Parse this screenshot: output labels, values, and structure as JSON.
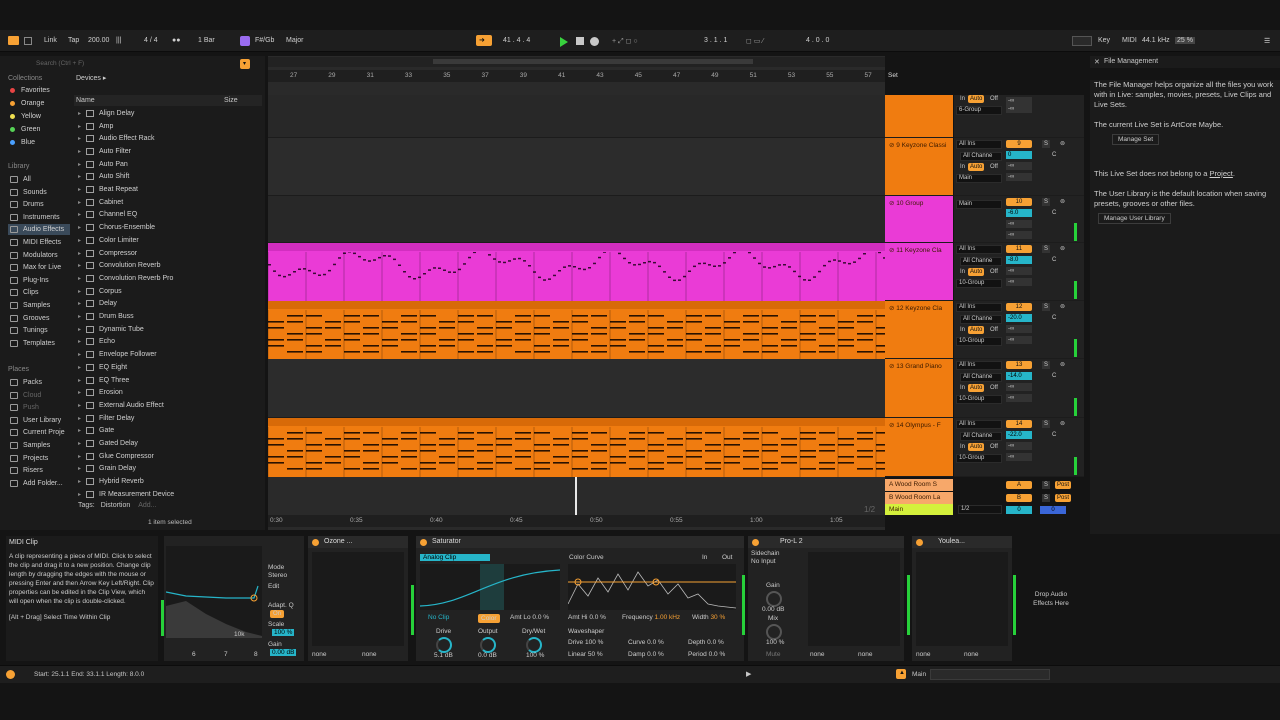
{
  "toolbar": {
    "link": "Link",
    "tap": "Tap",
    "tempo": "200.00",
    "signature": "4 / 4",
    "quantize": "1 Bar",
    "key": "F#/Gb",
    "scale": "Major",
    "position": "41 . 4 . 4",
    "loop_start": "3 . 1 . 1",
    "loop_length": "4 . 0 . 0",
    "key_label": "Key",
    "midi_label": "MIDI",
    "sample_rate": "44.1 kHz",
    "cpu": "25 %"
  },
  "browser": {
    "search_placeholder": "Search (Ctrl + F)",
    "collections_label": "Collections",
    "collections": [
      {
        "label": "Favorites",
        "color": "#e84444"
      },
      {
        "label": "Orange",
        "color": "#f7a134"
      },
      {
        "label": "Yellow",
        "color": "#f0e050"
      },
      {
        "label": "Green",
        "color": "#56d356"
      },
      {
        "label": "Blue",
        "color": "#4aa0ff"
      }
    ],
    "library_label": "Library",
    "library": [
      "All",
      "Sounds",
      "Drums",
      "Instruments",
      "Audio Effects",
      "MIDI Effects",
      "Modulators",
      "Max for Live",
      "Plug-Ins",
      "Clips",
      "Samples",
      "Grooves",
      "Tunings",
      "Templates"
    ],
    "places_label": "Places",
    "places": [
      "Packs",
      "Cloud",
      "Push",
      "User Library",
      "Current Proje",
      "Samples",
      "Projects",
      "Risers",
      "Add Folder..."
    ],
    "breadcrumb": "Devices ▸",
    "col_name": "Name",
    "col_size": "Size",
    "devices": [
      "Align Delay",
      "Amp",
      "Audio Effect Rack",
      "Auto Filter",
      "Auto Pan",
      "Auto Shift",
      "Beat Repeat",
      "Cabinet",
      "Channel EQ",
      "Chorus-Ensemble",
      "Color Limiter",
      "Compressor",
      "Convolution Reverb",
      "Convolution Reverb Pro",
      "Corpus",
      "Delay",
      "Drum Buss",
      "Dynamic Tube",
      "Echo",
      "Envelope Follower",
      "EQ Eight",
      "EQ Three",
      "Erosion",
      "External Audio Effect",
      "Filter Delay",
      "Gate",
      "Gated Delay",
      "Glue Compressor",
      "Grain Delay",
      "Hybrid Reverb",
      "IR Measurement Device"
    ],
    "tags_label": "Tags:",
    "tag": "Distortion",
    "tag_add": "Add...",
    "selected": "1 item selected"
  },
  "ruler": {
    "bars": [
      "27",
      "29",
      "31",
      "33",
      "35",
      "37",
      "39",
      "41",
      "43",
      "45",
      "47",
      "49",
      "51",
      "53",
      "55",
      "57"
    ],
    "set_label": "Set",
    "times": [
      "0:30",
      "0:35",
      "0:40",
      "0:45",
      "0:50",
      "0:55",
      "1:00",
      "1:05"
    ],
    "page": "1/2"
  },
  "tracks": [
    {
      "name": "",
      "color": "#f07c10",
      "input": "",
      "channel": "6-Group",
      "number": "",
      "vol": ""
    },
    {
      "name": "9 Keyzone Classi",
      "color": "#f07c10",
      "input": "All Ins",
      "channel": "Main",
      "number": "9",
      "vol": "0"
    },
    {
      "name": "10 Group",
      "color": "#ea3bd6",
      "input": "",
      "channel": "Main",
      "number": "10",
      "vol": "-6.0"
    },
    {
      "name": "11 Keyzone Cla",
      "color": "#ea3bd6",
      "input": "All Ins",
      "channel": "10-Group",
      "number": "11",
      "vol": "-8.0"
    },
    {
      "name": "12 Keyzone Cla",
      "color": "#f07c10",
      "input": "All Ins",
      "channel": "10-Group",
      "number": "12",
      "vol": "-20.0"
    },
    {
      "name": "13 Grand Piano",
      "color": "#f07c10",
      "input": "All Ins",
      "channel": "10-Group",
      "number": "13",
      "vol": "-14.0"
    },
    {
      "name": "14 Olympus - F",
      "color": "#f07c10",
      "input": "All Ins",
      "channel": "10-Group",
      "number": "14",
      "vol": "-22.0"
    }
  ],
  "mixer": {
    "all_ins": "All Ins",
    "all_chan": "All Channe",
    "in": "In",
    "auto": "Auto",
    "off": "Off",
    "s": "S",
    "c": "C",
    "inf": "-∞",
    "post": "Post"
  },
  "returns": [
    {
      "name": "A Wood Room S",
      "letter": "A"
    },
    {
      "name": "B Wood Room La",
      "letter": "B"
    }
  ],
  "main": {
    "name": "Main",
    "out": "1/2",
    "vol": "0",
    "pan": "0"
  },
  "info": {
    "title": "File Management",
    "p1": "The File Manager helps organize all the files you work with in Live: samples, movies, presets, Live Clips and Live Sets.",
    "p2": "The current Live Set is ArtCore Maybe.",
    "btn1": "Manage Set",
    "p3_pre": "This Live Set does not belong to a",
    "p3_link": "Project",
    "p3_end": ".",
    "p4": "The User Library is the default location when saving presets, grooves or other files.",
    "btn2": "Manage User Library"
  },
  "help": {
    "title": "MIDI Clip",
    "body": "A clip representing a piece of MIDI. Click to select the clip and drag it to a new position. Change clip length by dragging the edges with the mouse or pressing Enter and then Arrow Key Left/Right. Clip properties can be edited in the Clip View, which will open when the clip is double-clicked.",
    "hint": "[Alt + Drag] Select Time Within Clip"
  },
  "devices": {
    "eq": {
      "mode_label": "Mode",
      "mode": "Stereo",
      "edit": "Edit",
      "adapt": "Adapt. Q",
      "on": "On",
      "scale": "Scale",
      "scale_val": "100 %",
      "gain": "Gain",
      "gain_val": "0.00 dB",
      "freq_mark": "10k",
      "b1": "6",
      "b2": "7",
      "b3": "8"
    },
    "ozone": {
      "name": "Ozone ...",
      "none": "none"
    },
    "saturator": {
      "name": "Saturator",
      "mode": "Analog Clip",
      "noclip": "No Clip",
      "color": "Color",
      "amtlo": "Amt Lo",
      "amtlo_val": "0.0 %",
      "drive": "Drive",
      "drive_val": "5.1 dB",
      "output": "Output",
      "output_val": "0.0 dB",
      "drywet": "Dry/Wet",
      "drywet_val": "100 %",
      "curve_title": "Color Curve",
      "in": "In",
      "out": "Out",
      "amthi": "Amt Hi",
      "amthi_val": "0.0 %",
      "freq": "Frequency",
      "freq_val": "1.00 kHz",
      "width": "Width",
      "width_val": "30 %",
      "ws": "Waveshaper",
      "ws_drive": "Drive",
      "ws_drive_val": "100 %",
      "ws_curve": "Curve",
      "ws_curve_val": "0.0 %",
      "ws_depth": "Depth",
      "ws_depth_val": "0.0 %",
      "ws_lin": "Linear",
      "ws_lin_val": "50 %",
      "ws_damp": "Damp",
      "ws_damp_val": "0.0 %",
      "ws_period": "Period",
      "ws_period_val": "0.0 %"
    },
    "prol": {
      "name": "Pro-L 2",
      "sidechain": "Sidechain",
      "noinput": "No Input",
      "gain": "Gain",
      "gain_val": "0.00 dB",
      "mix": "Mix",
      "mix_val": "100 %",
      "mute": "Mute",
      "none": "none"
    },
    "youlean": {
      "name": "Youlea...",
      "none": "none"
    },
    "drop": "Drop Audio Effects Here"
  },
  "status": {
    "text": "Start: 25.1.1  End: 33.1.1  Length: 8.0.0",
    "track": "Main"
  }
}
